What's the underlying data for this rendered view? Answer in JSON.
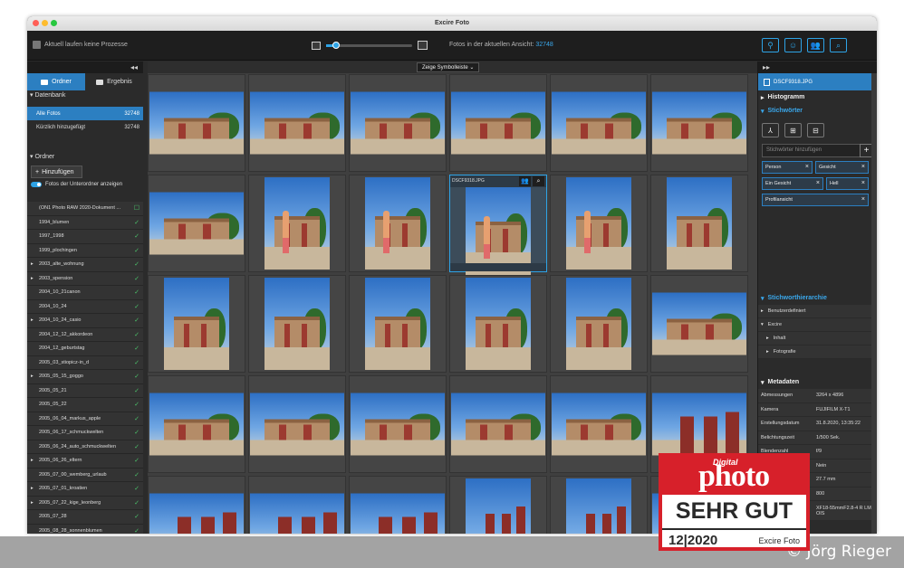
{
  "window": {
    "title": "Excire Foto"
  },
  "toolbar": {
    "status": "Aktuell laufen keine Prozesse",
    "zoom_level": 0.12,
    "count_label": "Fotos in der aktuellen Ansicht:",
    "count_value": "32748"
  },
  "left": {
    "collapse": "◂◂",
    "tabs": [
      {
        "label": "Ordner"
      },
      {
        "label": "Ergebnis"
      }
    ],
    "database_section": "Datenbank",
    "db_rows": [
      {
        "label": "Alle Fotos",
        "count": "32748"
      },
      {
        "label": "Kürzlich hinzugefügt",
        "count": "32748"
      }
    ],
    "folder_section": "Ordner",
    "add_button": "Hinzufügen",
    "subfolder_toggle": "Fotos der Unterordner anzeigen",
    "folders": [
      {
        "label": "(ON1 Photo RAW 2020-Dokument ...",
        "arrow": "",
        "check": "☐"
      },
      {
        "label": "1994_blumen",
        "arrow": "",
        "check": "✓"
      },
      {
        "label": "1997_1998",
        "arrow": "",
        "check": "✓"
      },
      {
        "label": "1999_plochingen",
        "arrow": "",
        "check": "✓"
      },
      {
        "label": "2003_alte_wohnung",
        "arrow": "▸",
        "check": "✓"
      },
      {
        "label": "2003_spension",
        "arrow": "▸",
        "check": "✓"
      },
      {
        "label": "2004_10_21canon",
        "arrow": "",
        "check": "✓"
      },
      {
        "label": "2004_10_24",
        "arrow": "",
        "check": "✓"
      },
      {
        "label": "2004_10_24_casio",
        "arrow": "▸",
        "check": "✓"
      },
      {
        "label": "2004_12_12_akkordeon",
        "arrow": "",
        "check": "✓"
      },
      {
        "label": "2004_12_geburtstag",
        "arrow": "",
        "check": "✓"
      },
      {
        "label": "2005_03_stiopicz-in_d",
        "arrow": "",
        "check": "✓"
      },
      {
        "label": "2005_05_15_goggo",
        "arrow": "▸",
        "check": "✓"
      },
      {
        "label": "2005_05_21",
        "arrow": "",
        "check": "✓"
      },
      {
        "label": "2005_05_22",
        "arrow": "",
        "check": "✓"
      },
      {
        "label": "2005_06_04_markus_apple",
        "arrow": "",
        "check": "✓"
      },
      {
        "label": "2005_06_17_schmuckwelten",
        "arrow": "",
        "check": "✓"
      },
      {
        "label": "2005_06_24_auto_schmuckwelten",
        "arrow": "",
        "check": "✓"
      },
      {
        "label": "2005_06_26_eltern",
        "arrow": "▸",
        "check": "✓"
      },
      {
        "label": "2005_07_00_wemberg_urlaub",
        "arrow": "",
        "check": "✓"
      },
      {
        "label": "2005_07_01_kroatien",
        "arrow": "▸",
        "check": "✓"
      },
      {
        "label": "2005_07_22_kige_leonberg",
        "arrow": "▸",
        "check": "✓"
      },
      {
        "label": "2005_07_28",
        "arrow": "",
        "check": "✓"
      },
      {
        "label": "2005_08_28_sonnenblumen",
        "arrow": "",
        "check": "✓"
      }
    ]
  },
  "center": {
    "symbolbar_button": "Zeige Symbolleiste ⌄",
    "selected_filename": "DSCF9318.JPG"
  },
  "right": {
    "expand": "▸▸",
    "filename": "DSCF9318.JPG",
    "histogram": "Histogramm",
    "keywords": "Stichwörter",
    "keyword_placeholder": "Stichwörter hinzufügen",
    "tags": [
      "Person",
      "Gesicht",
      "Ein Gesicht",
      "Hell",
      "Profilansicht"
    ],
    "hierarchy": "Stichworthierarchie",
    "hierarchy_rows": [
      {
        "label": "Benutzerdefiniert",
        "arrow": "▸",
        "indent": 0
      },
      {
        "label": "Excire",
        "arrow": "▾",
        "indent": 0
      },
      {
        "label": "Inhalt",
        "arrow": "▸",
        "indent": 1
      },
      {
        "label": "Fotografie",
        "arrow": "▸",
        "indent": 1
      }
    ],
    "metadata": "Metadaten",
    "meta_rows": [
      {
        "k": "Abmessungen",
        "v": "3264 x 4896"
      },
      {
        "k": "Kamera",
        "v": "FUJIFILM X-T1"
      },
      {
        "k": "Erstellungsdatum",
        "v": "31.8.2020, 13:35:22"
      },
      {
        "k": "Belichtungszeit",
        "v": "1/500 Sek."
      },
      {
        "k": "Blendenzahl",
        "v": "f/9"
      },
      {
        "k": "",
        "v": "Nein"
      },
      {
        "k": "",
        "v": "27.7 mm"
      },
      {
        "k": "",
        "v": "800"
      },
      {
        "k": "",
        "v": "XF18-55mmF2.8-4 R LM OIS"
      }
    ]
  },
  "badge": {
    "digital": "Digital",
    "photo": "photo",
    "grade": "SEHR GUT",
    "date": "12|2020",
    "product": "Excire Foto"
  },
  "copyright": "© Jörg Rieger",
  "colors": {
    "accent": "#2c7fc1",
    "badge_red": "#d7202a"
  }
}
